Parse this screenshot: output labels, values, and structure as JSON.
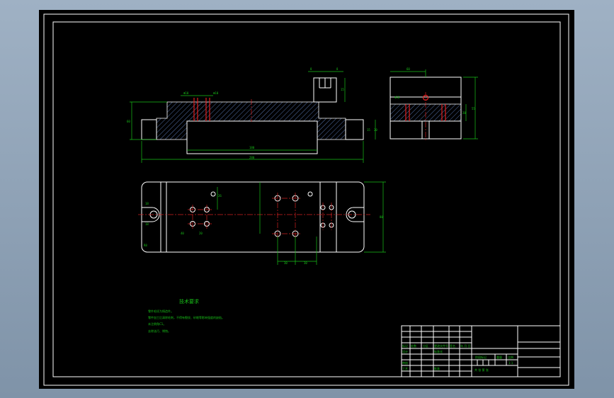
{
  "technical_requirements": {
    "heading": "技术要求",
    "items": [
      "零件毛坯为铸造件。",
      "零件加工后清除毛刺，不得有裂纹、砂眼等影响强度的缺陷。",
      "未注倒角C1。",
      "去除油污、锈蚀。"
    ]
  },
  "dimensions": {
    "front_total": "280",
    "front_inner": "180",
    "side_width": "60",
    "plan_height": "80",
    "plan_bottom_left": "30",
    "plan_bottom_right": "30"
  },
  "title_block": {
    "mark": "标记",
    "count": "处数",
    "zone": "分区",
    "change_doc": "更改文件号",
    "sign": "签名",
    "date": "年.月.日",
    "design": "设计",
    "standardize": "标准化",
    "review": "审核",
    "process": "工艺",
    "approve": "批准",
    "stage_mark": "阶段标记",
    "weight": "重量",
    "scale": "比例",
    "scale_value": "1:1",
    "sheets": "共 张 第 张"
  }
}
